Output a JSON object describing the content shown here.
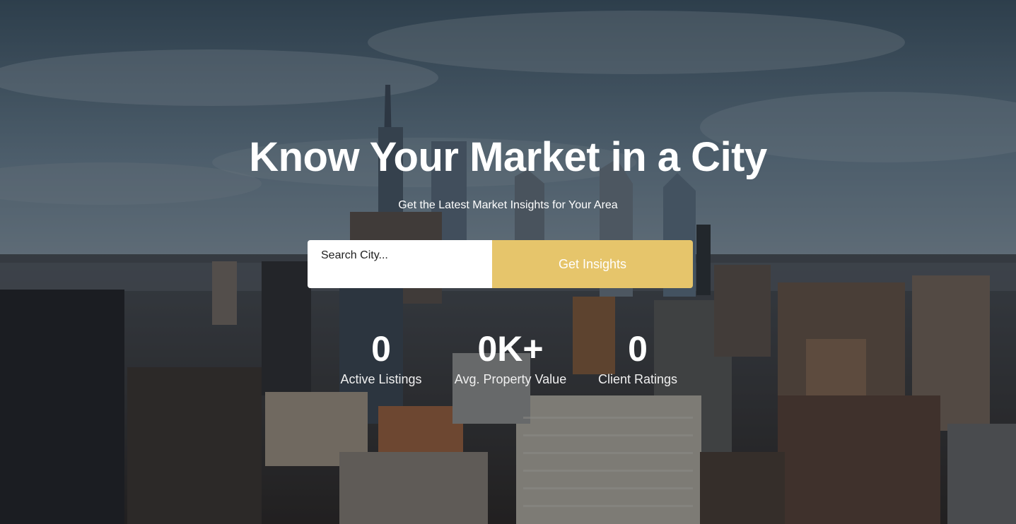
{
  "hero": {
    "title": "Know Your Market in a City",
    "subtitle": "Get the Latest Market Insights for Your Area",
    "background_image": "city-skyline-photo"
  },
  "search": {
    "placeholder": "Search City...",
    "value": "",
    "button_label": "Get Insights"
  },
  "stats": [
    {
      "value": "0",
      "label": "Active Listings"
    },
    {
      "value": "0K+",
      "label": "Avg. Property Value"
    },
    {
      "value": "0",
      "label": "Client Ratings"
    }
  ],
  "colors": {
    "accent": "#e6c56b",
    "text": "#ffffff",
    "input_bg": "#ffffff"
  }
}
